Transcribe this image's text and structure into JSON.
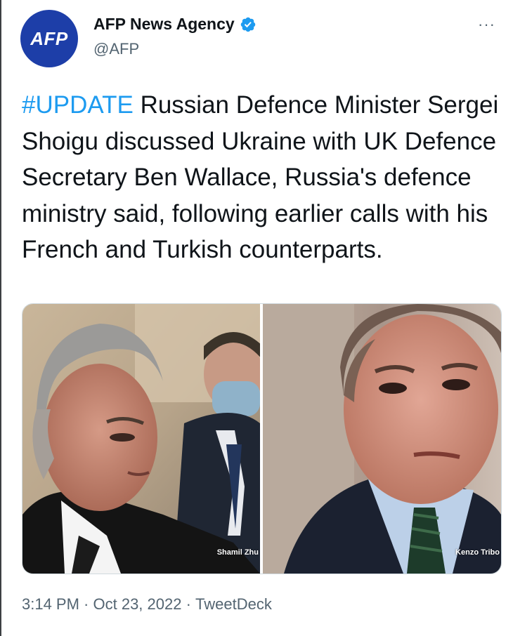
{
  "author": {
    "avatar_text": "AFP",
    "name": "AFP News Agency",
    "handle": "@AFP",
    "verified": true
  },
  "more_button": "···",
  "tweet": {
    "hashtag": "#UPDATE",
    "body": " Russian Defence Minister Sergei Shoigu discussed Ukraine with UK Defence Secretary Ben Wallace, Russia's defence ministry said, following earlier calls with his French and Turkish counterparts."
  },
  "media": {
    "left_credit": "Shamil Zhu",
    "right_credit": "Kenzo Tribo"
  },
  "meta": {
    "time": "3:14 PM",
    "separator": " · ",
    "date": "Oct 23, 2022",
    "source": "TweetDeck"
  },
  "colors": {
    "hashtag": "#1d9bf0",
    "avatar_bg": "#1d3ea8",
    "verified": "#1d9bf0",
    "secondary_text": "#536471"
  },
  "icons": [
    "verified-badge-icon",
    "more-options-icon"
  ]
}
